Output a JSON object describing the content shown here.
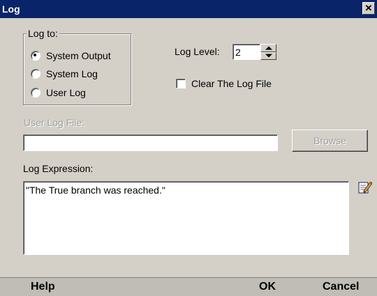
{
  "window": {
    "title": "Log",
    "close_glyph": "✕"
  },
  "log_to": {
    "legend": "Log to:",
    "options": [
      {
        "label": "System Output",
        "checked": true
      },
      {
        "label": "System Log",
        "checked": false
      },
      {
        "label": "User Log",
        "checked": false
      }
    ]
  },
  "log_level": {
    "label": "Log Level:",
    "value": "2"
  },
  "clear_log": {
    "label": "Clear The Log File",
    "checked": false
  },
  "user_log_file": {
    "label": "User Log File:",
    "value": "",
    "browse_label": "Browse"
  },
  "log_expression": {
    "label": "Log Expression:",
    "value": "\"The True branch was reached.\"",
    "edit_icon": "edit-pencil-icon"
  },
  "footer": {
    "help_label": "Help",
    "ok_label": "OK",
    "cancel_label": "Cancel"
  }
}
